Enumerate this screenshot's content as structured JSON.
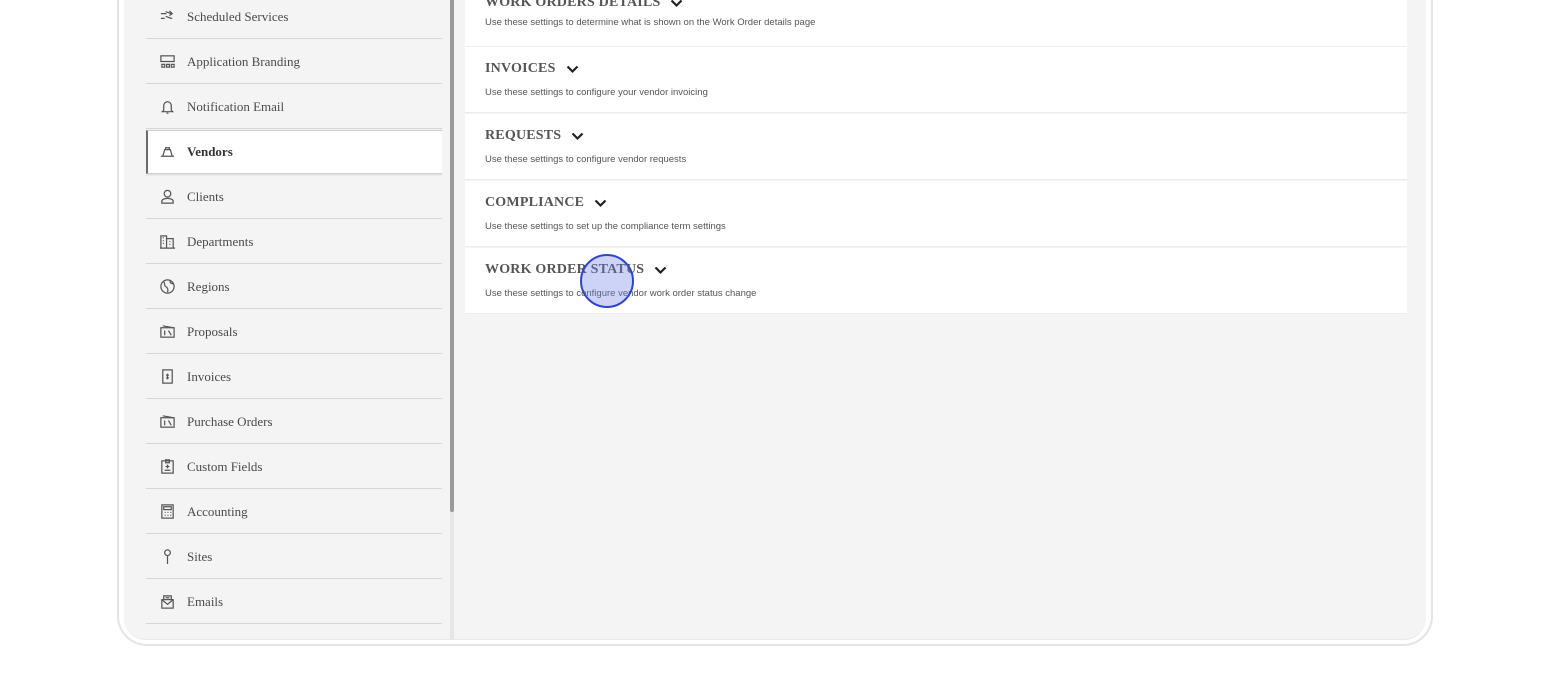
{
  "sidebar": {
    "items": [
      {
        "label": "Scheduled Services",
        "icon": "scheduled-services-icon"
      },
      {
        "label": "Application Branding",
        "icon": "branding-icon"
      },
      {
        "label": "Notification Email",
        "icon": "bell-icon"
      },
      {
        "label": "Vendors",
        "icon": "vendor-icon",
        "active": true
      },
      {
        "label": "Clients",
        "icon": "user-icon"
      },
      {
        "label": "Departments",
        "icon": "building-icon"
      },
      {
        "label": "Regions",
        "icon": "globe-icon"
      },
      {
        "label": "Proposals",
        "icon": "proposal-icon"
      },
      {
        "label": "Invoices",
        "icon": "invoice-icon"
      },
      {
        "label": "Purchase Orders",
        "icon": "purchase-order-icon"
      },
      {
        "label": "Custom Fields",
        "icon": "clipboard-icon"
      },
      {
        "label": "Accounting",
        "icon": "calculator-icon"
      },
      {
        "label": "Sites",
        "icon": "pin-icon"
      },
      {
        "label": "Emails",
        "icon": "mail-icon"
      }
    ]
  },
  "sections": [
    {
      "title": "WORK ORDERS DETAILS",
      "description": "Use these settings to determine what is shown on the Work Order details page"
    },
    {
      "title": "INVOICES",
      "description": "Use these settings to configure your vendor invoicing"
    },
    {
      "title": "REQUESTS",
      "description": "Use these settings to configure vendor requests"
    },
    {
      "title": "COMPLIANCE",
      "description": "Use these settings to set up the compliance term settings"
    },
    {
      "title": "WORK ORDER STATUS",
      "description": "Use these settings to configure vendor work order status change"
    }
  ],
  "colors": {
    "active_border": "#6b6b6b",
    "click_marker": "#2f45c8"
  }
}
